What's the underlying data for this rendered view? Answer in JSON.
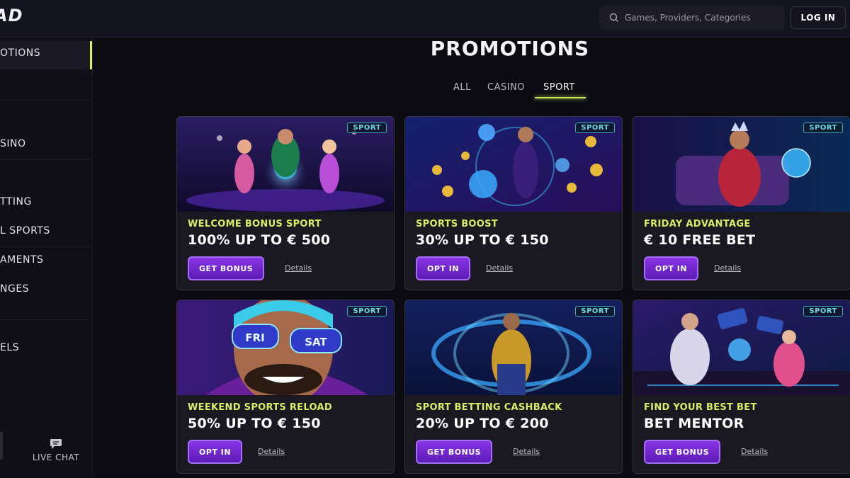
{
  "header": {
    "logo_text": "AD",
    "search_placeholder": "Games, Providers, Categories",
    "login_label": "LOG IN"
  },
  "sidebar": {
    "items": [
      {
        "label": "OTIONS",
        "active": true
      },
      {
        "label": "SINO"
      },
      {
        "label": "TTING"
      },
      {
        "label": "L SPORTS"
      },
      {
        "label": "AMENTS"
      },
      {
        "label": "NGES"
      },
      {
        "label": "ELS"
      }
    ],
    "live_chat_label": "LIVE CHAT"
  },
  "page": {
    "title": "PROMOTIONS",
    "tabs": [
      {
        "label": "ALL"
      },
      {
        "label": "CASINO"
      },
      {
        "label": "SPORT",
        "active": true
      }
    ]
  },
  "cards": [
    {
      "badge": "SPORT",
      "subtitle": "WELCOME BONUS SPORT",
      "headline": "100% UP TO € 500",
      "button": "GET BONUS",
      "details": "Details"
    },
    {
      "badge": "SPORT",
      "subtitle": "SPORTS BOOST",
      "headline": "30% UP TO € 150",
      "button": "OPT IN",
      "details": "Details"
    },
    {
      "badge": "SPORT",
      "subtitle": "FRIDAY ADVANTAGE",
      "headline": "€ 10 FREE BET",
      "button": "OPT IN",
      "details": "Details"
    },
    {
      "badge": "SPORT",
      "subtitle": "WEEKEND SPORTS RELOAD",
      "headline": "50% UP TO € 150",
      "button": "OPT IN",
      "details": "Details",
      "art_text": [
        "FRI",
        "SAT"
      ]
    },
    {
      "badge": "SPORT",
      "subtitle": "SPORT BETTING CASHBACK",
      "headline": "20% UP TO € 200",
      "button": "GET BONUS",
      "details": "Details"
    },
    {
      "badge": "SPORT",
      "subtitle": "FIND YOUR BEST BET",
      "headline": "BET MENTOR",
      "button": "GET BONUS",
      "details": "Details"
    }
  ],
  "colors": {
    "accent_lime": "#d8ef63",
    "button_purple": "#7a2ad6",
    "badge_cyan": "#6fd6e0"
  }
}
